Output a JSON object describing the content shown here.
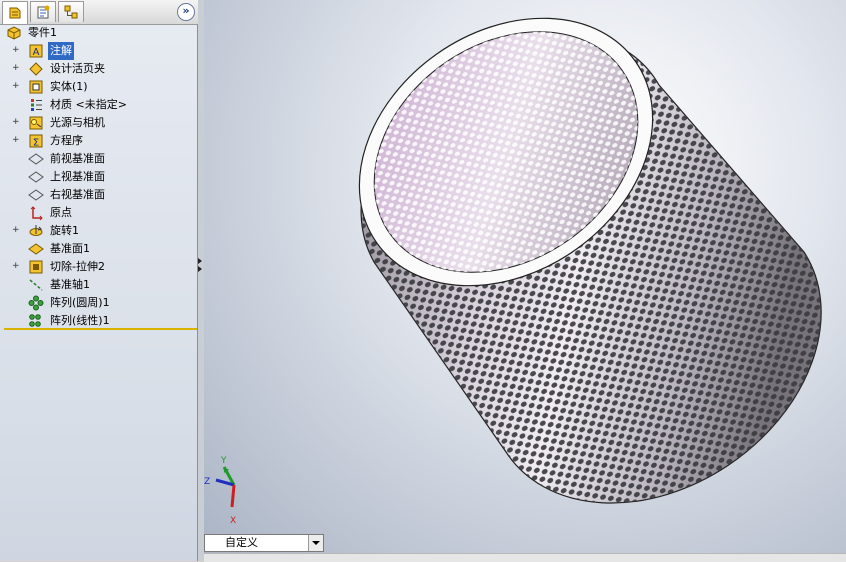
{
  "panel": {
    "tabs": [
      {
        "name": "feature-manager-icon"
      },
      {
        "name": "property-manager-icon"
      },
      {
        "name": "configuration-manager-icon"
      }
    ],
    "collapse_label": "»"
  },
  "tree": {
    "root": {
      "label": "零件1",
      "icon": "part-icon"
    },
    "items": [
      {
        "label": "注解",
        "icon": "annotations-icon",
        "expandable": true,
        "selected": true
      },
      {
        "label": "设计活页夹",
        "icon": "design-binder-icon",
        "expandable": true
      },
      {
        "label": "实体(1)",
        "icon": "solid-bodies-icon",
        "expandable": true
      },
      {
        "label": "材质 <未指定>",
        "icon": "material-icon",
        "expandable": false
      },
      {
        "label": "光源与相机",
        "icon": "lights-cameras-icon",
        "expandable": true
      },
      {
        "label": "方程序",
        "icon": "equations-icon",
        "expandable": true
      },
      {
        "label": "前视基准面",
        "icon": "plane-icon",
        "expandable": false
      },
      {
        "label": "上视基准面",
        "icon": "plane-icon",
        "expandable": false
      },
      {
        "label": "右视基准面",
        "icon": "plane-icon",
        "expandable": false
      },
      {
        "label": "原点",
        "icon": "origin-icon",
        "expandable": false
      },
      {
        "label": "旋转1",
        "icon": "revolve-icon",
        "expandable": true
      },
      {
        "label": "基准面1",
        "icon": "ref-plane-icon",
        "expandable": false
      },
      {
        "label": "切除-拉伸2",
        "icon": "cut-extrude-icon",
        "expandable": true
      },
      {
        "label": "基准轴1",
        "icon": "axis-icon",
        "expandable": false
      },
      {
        "label": "阵列(圆周)1",
        "icon": "circular-pattern-icon",
        "expandable": false
      },
      {
        "label": "阵列(线性)1",
        "icon": "linear-pattern-icon",
        "expandable": false
      }
    ]
  },
  "viewport": {
    "model": "perforated-cylinder",
    "triad": {
      "x": "X",
      "y": "Y",
      "z": "Z"
    },
    "colors": {
      "x": "#cc1f1f",
      "y": "#1f9a2a",
      "z": "#1f2fbf"
    }
  },
  "view_combo": {
    "value": "自定义"
  }
}
